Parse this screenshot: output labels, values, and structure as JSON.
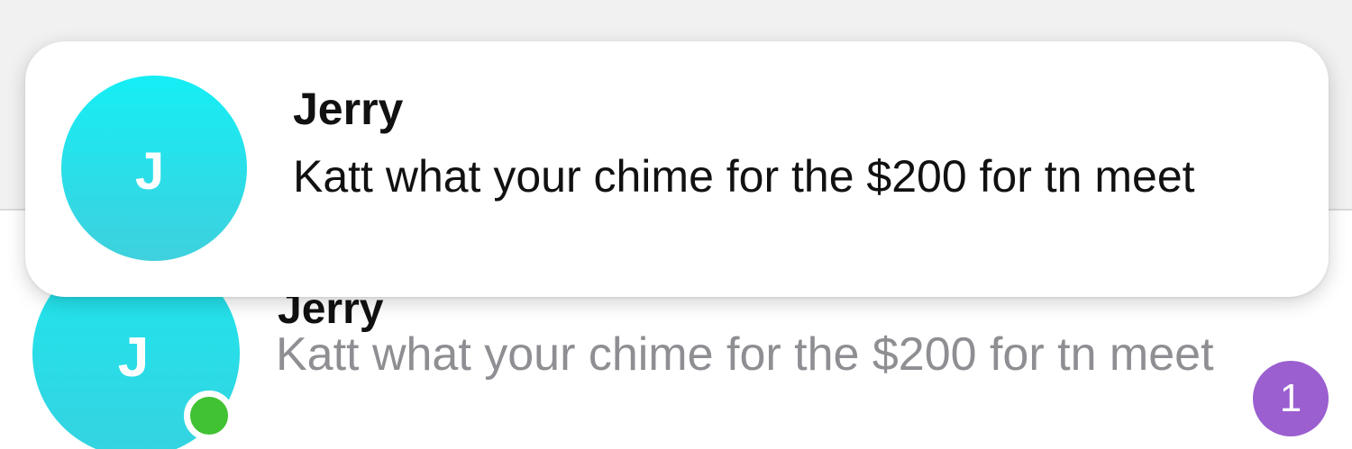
{
  "banner": {
    "sender": "Jerry",
    "avatar_initial": "J",
    "message": "Katt what your chime for the $200 for tn meet"
  },
  "chat_row": {
    "sender": "Jerry",
    "avatar_initial": "J",
    "preview": "Katt what your chime for the $200 for tn meet",
    "unread_count": "1",
    "online": true
  },
  "colors": {
    "avatar": "#1ee6ee",
    "online_dot": "#41c233",
    "unread_badge": "#9b5fd0",
    "preview_text": "#8e8e93"
  },
  "icons": [
    "avatar-initial",
    "online-status-dot",
    "unread-count-badge"
  ]
}
